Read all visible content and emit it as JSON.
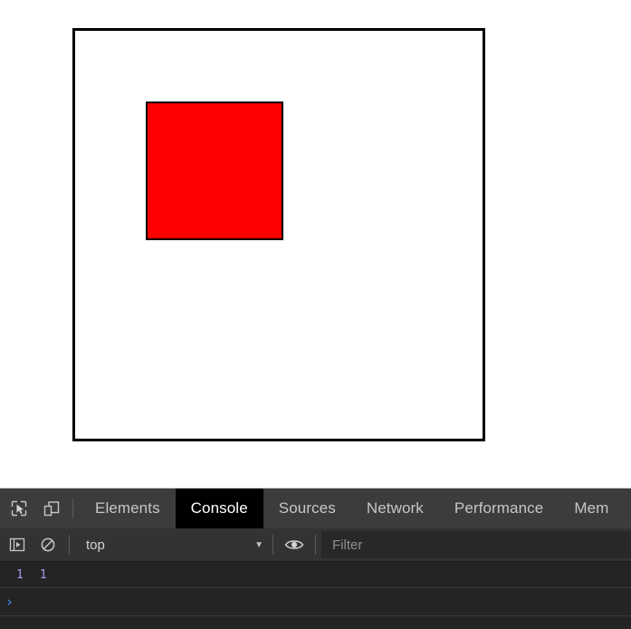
{
  "page": {
    "background_color": "#ffffff",
    "outer_box": {
      "name": "outer-container-box",
      "border_color": "#000000",
      "fill_color": "#ffffff"
    },
    "red_square": {
      "name": "red-square",
      "fill_color": "#ff0000",
      "border_color": "#000000"
    }
  },
  "devtools": {
    "background_color": "#242424",
    "tabbar": {
      "background_color": "#3c3c3c",
      "icons": [
        {
          "name": "inspect-element-icon",
          "title": "Inspect element"
        },
        {
          "name": "device-toolbar-icon",
          "title": "Toggle device toolbar"
        }
      ],
      "tabs": [
        {
          "label": "Elements",
          "active": false
        },
        {
          "label": "Console",
          "active": true
        },
        {
          "label": "Sources",
          "active": false
        },
        {
          "label": "Network",
          "active": false
        },
        {
          "label": "Performance",
          "active": false
        },
        {
          "label": "Mem",
          "active": false
        }
      ]
    },
    "filterbar": {
      "icons": [
        {
          "name": "console-sidebar-icon",
          "title": "Show console sidebar"
        },
        {
          "name": "clear-console-icon",
          "title": "Clear console"
        }
      ],
      "context_selector": {
        "value": "top",
        "caret": "▼"
      },
      "eye_icon": {
        "name": "live-expression-icon",
        "title": "Create live expression"
      },
      "filter_input": {
        "value": "",
        "placeholder": "Filter"
      }
    },
    "console": {
      "messages": [
        {
          "values": [
            "1",
            "1"
          ],
          "color": "#a59bf5"
        }
      ],
      "prompt": {
        "chevron": "›",
        "value": "",
        "color": "#3b7fe0"
      }
    }
  }
}
